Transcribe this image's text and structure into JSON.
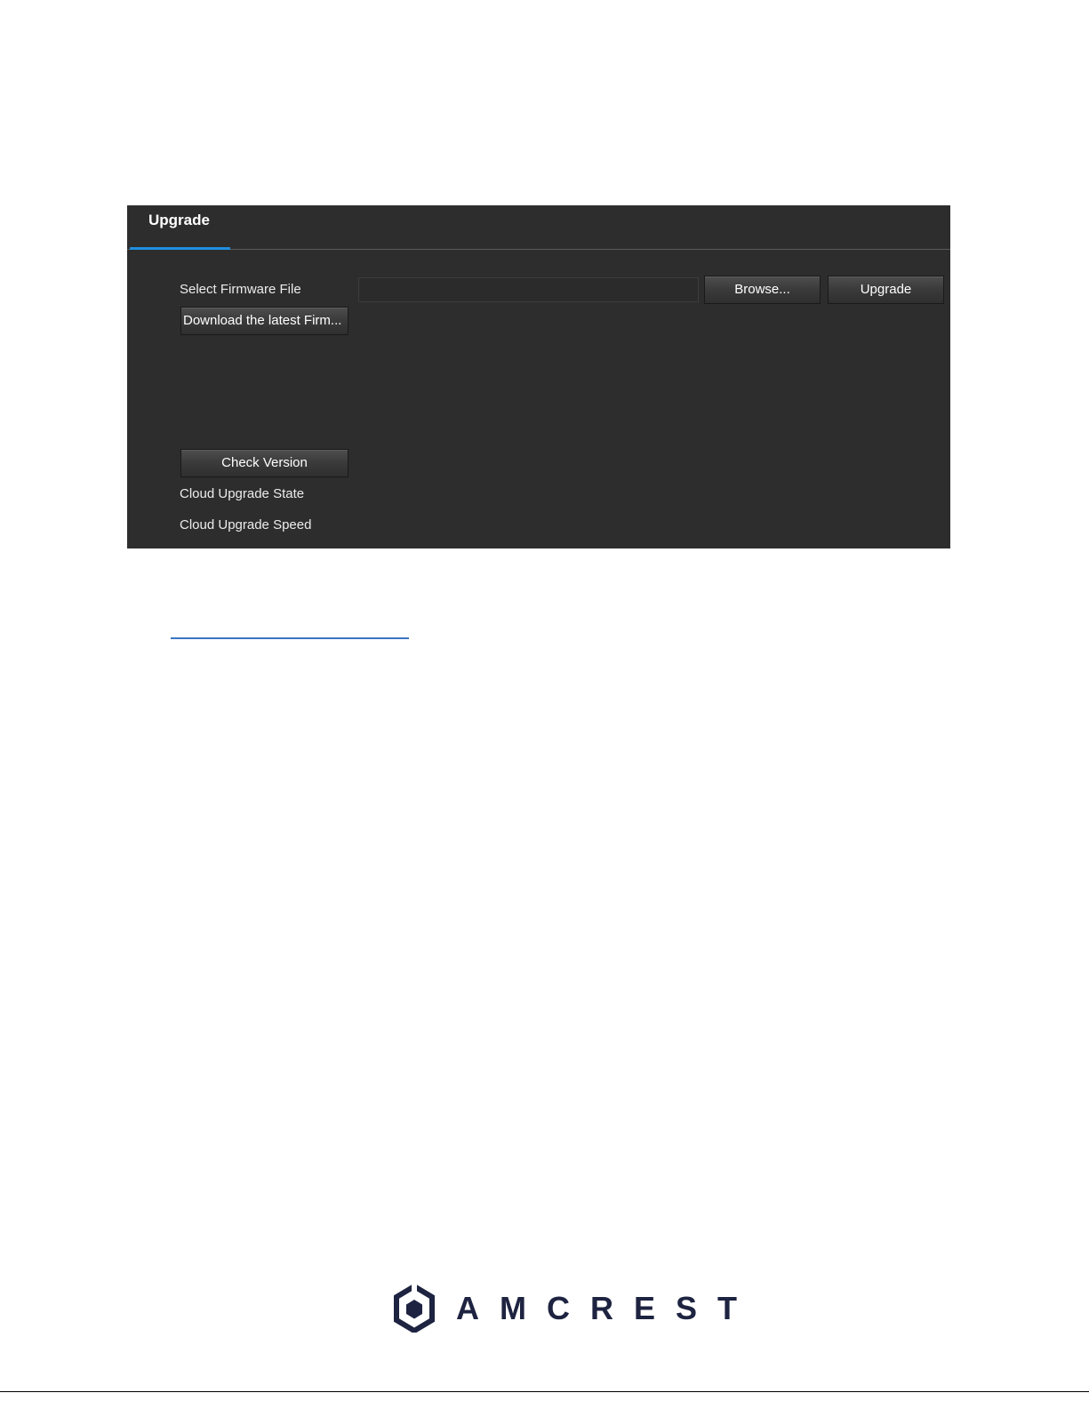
{
  "tab": {
    "label": "Upgrade"
  },
  "firmware": {
    "select_label": "Select Firmware File",
    "file_value": "",
    "browse_label": "Browse...",
    "upgrade_label": "Upgrade",
    "download_label": "Download the latest Firm..."
  },
  "cloud": {
    "check_version_label": "Check Version",
    "state_label": "Cloud Upgrade State",
    "speed_label": "Cloud Upgrade Speed"
  },
  "footer": {
    "brand": "AMCREST"
  },
  "colors": {
    "panel_bg": "#2d2d2d",
    "tab_accent": "#1e8fe0",
    "link": "#3a74c4",
    "brand": "#1d2340"
  },
  "icons": {
    "logo": "amcrest-hexagon-logo-icon"
  }
}
